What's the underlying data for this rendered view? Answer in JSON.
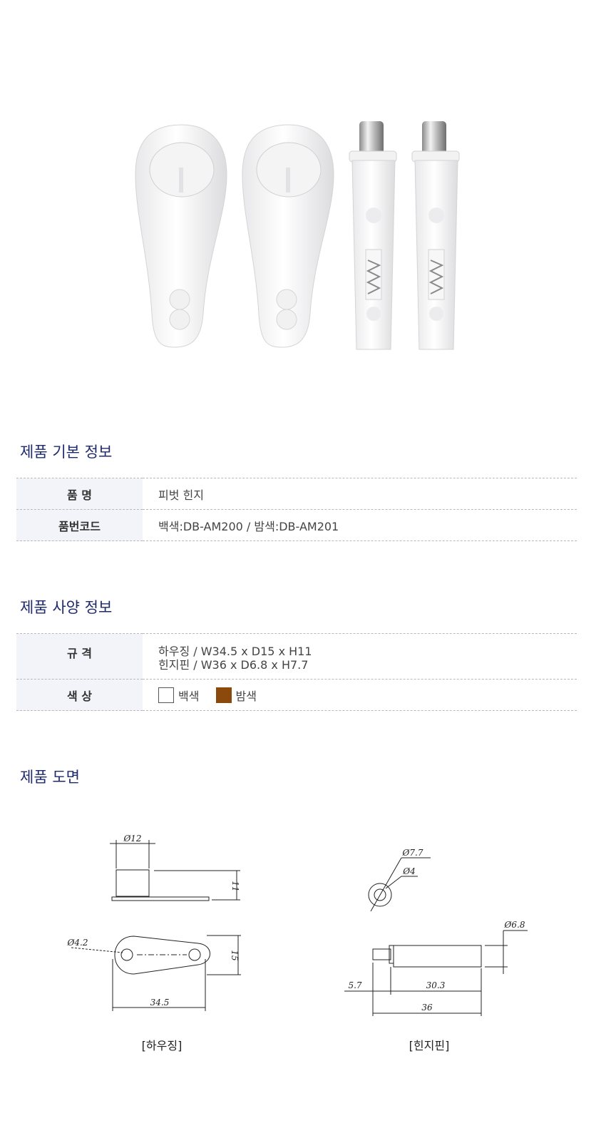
{
  "sections": {
    "basic_title": "제품 기본 정보",
    "spec_title": "제품 사양 정보",
    "drawing_title": "제품 도면"
  },
  "basic": {
    "name_label": "품 명",
    "name_value": "피벗 힌지",
    "code_label": "품번코드",
    "code_value": "백색:DB-AM200 / 밤색:DB-AM201"
  },
  "spec": {
    "size_label": "규 격",
    "size_line1": "하우징 / W34.5 x D15 x H11",
    "size_line2": "힌지핀 / W36 x D6.8 x H7.7",
    "color_label": "색 상",
    "colors": [
      {
        "name": "백색",
        "hex": "#ffffff"
      },
      {
        "name": "밤색",
        "hex": "#8b4a0c"
      }
    ]
  },
  "drawing": {
    "housing": {
      "caption": "[하우징]",
      "dim_top_diameter": "Ø12",
      "dim_height": "11",
      "dim_hole": "Ø4.2",
      "dim_width": "15",
      "dim_length": "34.5"
    },
    "pin": {
      "caption": "[힌지핀]",
      "dim_outer": "Ø7.7",
      "dim_inner": "Ø4",
      "dim_body": "Ø6.8",
      "dim_short": "5.7",
      "dim_mid": "30.3",
      "dim_total": "36"
    }
  },
  "colors": {
    "title": "#1f2a6e",
    "label_bg": "#f3f3fa"
  }
}
